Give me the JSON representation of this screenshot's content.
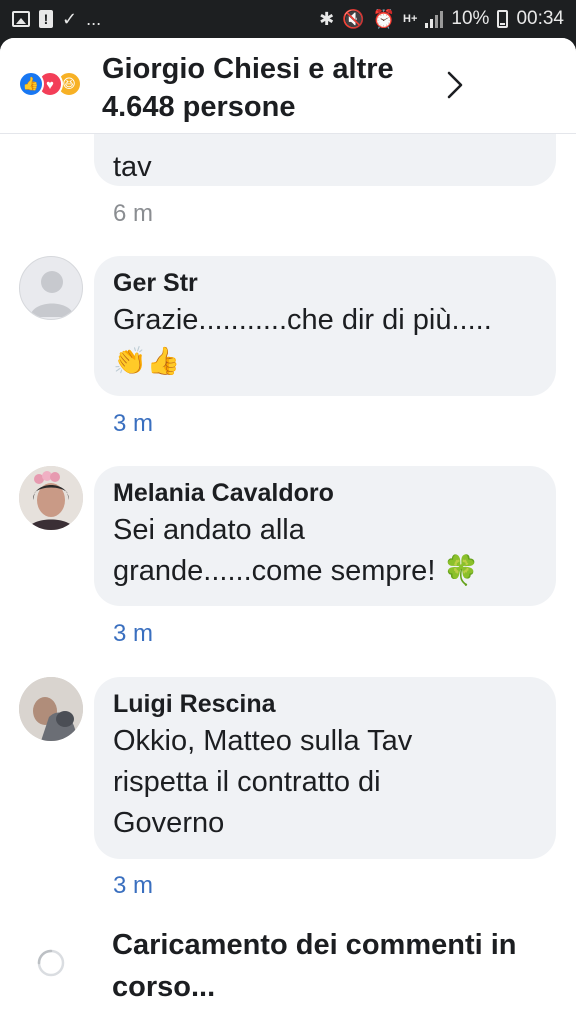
{
  "status_bar": {
    "left_icons": [
      "image-icon",
      "alert-icon",
      "check-icon"
    ],
    "more": "...",
    "battery_percent": "10%",
    "time": "00:34",
    "network": "H+"
  },
  "header": {
    "title": "Giorgio Chiesi e altre 4.648 persone",
    "reactions": [
      "like",
      "love",
      "haha"
    ],
    "like_glyph": "👍",
    "love_glyph": "♥",
    "haha_glyph": "😆"
  },
  "comments": [
    {
      "author": "",
      "text": "tav",
      "time": "6 m"
    },
    {
      "author": "Ger Str",
      "text_line1": "Grazie...........che dir di più.....",
      "emoji": "👏👍",
      "time": "3 m"
    },
    {
      "author": "Melania Cavaldoro",
      "text_line1": "Sei andato alla",
      "text_line2": "grande......come sempre! 🍀",
      "time": "3 m"
    },
    {
      "author": "Luigi Rescina",
      "text_line1": "Okkio, Matteo sulla Tav",
      "text_line2": "rispetta il contratto di",
      "text_line3": "Governo",
      "time": "3 m"
    }
  ],
  "loading": {
    "text": "Caricamento dei commenti in corso..."
  },
  "colors": {
    "like": "#1877f2",
    "love": "#f33e58",
    "haha": "#f7b125",
    "bubble": "#f0f2f5",
    "link_time": "#3a6fbf"
  }
}
